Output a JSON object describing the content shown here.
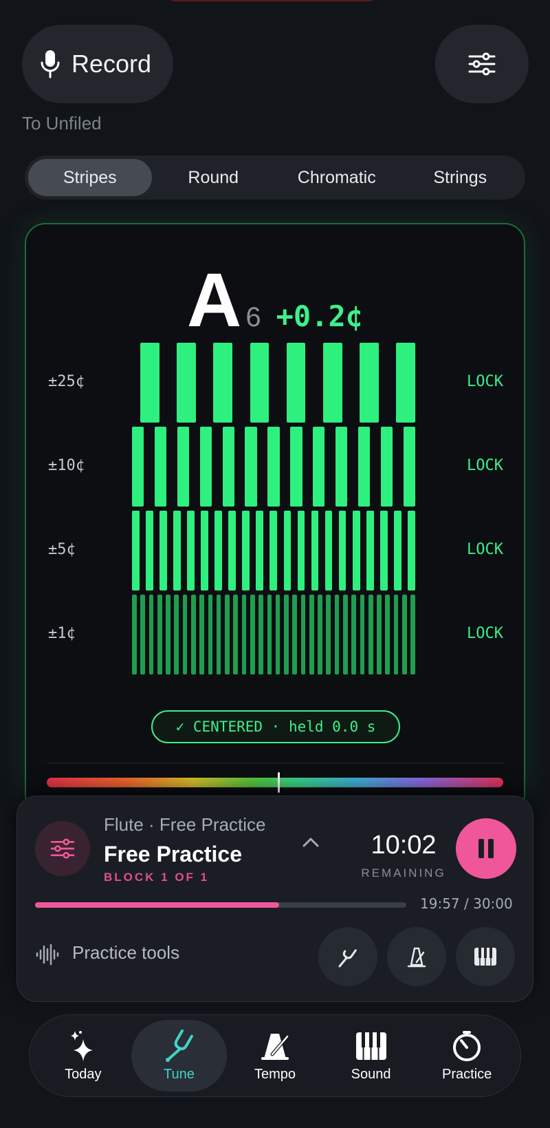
{
  "header": {
    "record_label": "Record",
    "destination": "To Unfiled"
  },
  "view_modes": {
    "items": [
      {
        "label": "Stripes",
        "active": true
      },
      {
        "label": "Round",
        "active": false
      },
      {
        "label": "Chromatic",
        "active": false
      },
      {
        "label": "Strings",
        "active": false
      }
    ]
  },
  "tuner": {
    "note": "A",
    "octave": "6",
    "cents": "+0.2¢",
    "rows": [
      {
        "label": "±25¢",
        "status": "LOCK",
        "stripes": 8,
        "color": "#2ef07e"
      },
      {
        "label": "±10¢",
        "status": "LOCK",
        "stripes": 13,
        "color": "#2ef07e"
      },
      {
        "label": "±5¢",
        "status": "LOCK",
        "stripes": 21,
        "color": "#2ef07e"
      },
      {
        "label": "±1¢",
        "status": "LOCK",
        "stripes": 34,
        "color": "#1f9e50"
      }
    ],
    "centered_text": "✓ CENTERED · held 0.0 s",
    "accent_color": "#3ef08a"
  },
  "practice": {
    "subtitle": "Flute · Free Practice",
    "title": "Free Practice",
    "block": "BLOCK 1 OF 1",
    "time_remaining": "10:02",
    "remaining_label": "REMAINING",
    "progress": 0.658,
    "progress_text": "19:57 / 30:00",
    "tools_label": "Practice tools",
    "accent_color": "#f0579a"
  },
  "tabs": [
    {
      "label": "Today",
      "icon": "sparkle-icon",
      "active": false
    },
    {
      "label": "Tune",
      "icon": "tuning-fork-icon",
      "active": true
    },
    {
      "label": "Tempo",
      "icon": "metronome-icon",
      "active": false
    },
    {
      "label": "Sound",
      "icon": "piano-icon",
      "active": false
    },
    {
      "label": "Practice",
      "icon": "timer-icon",
      "active": false
    }
  ]
}
